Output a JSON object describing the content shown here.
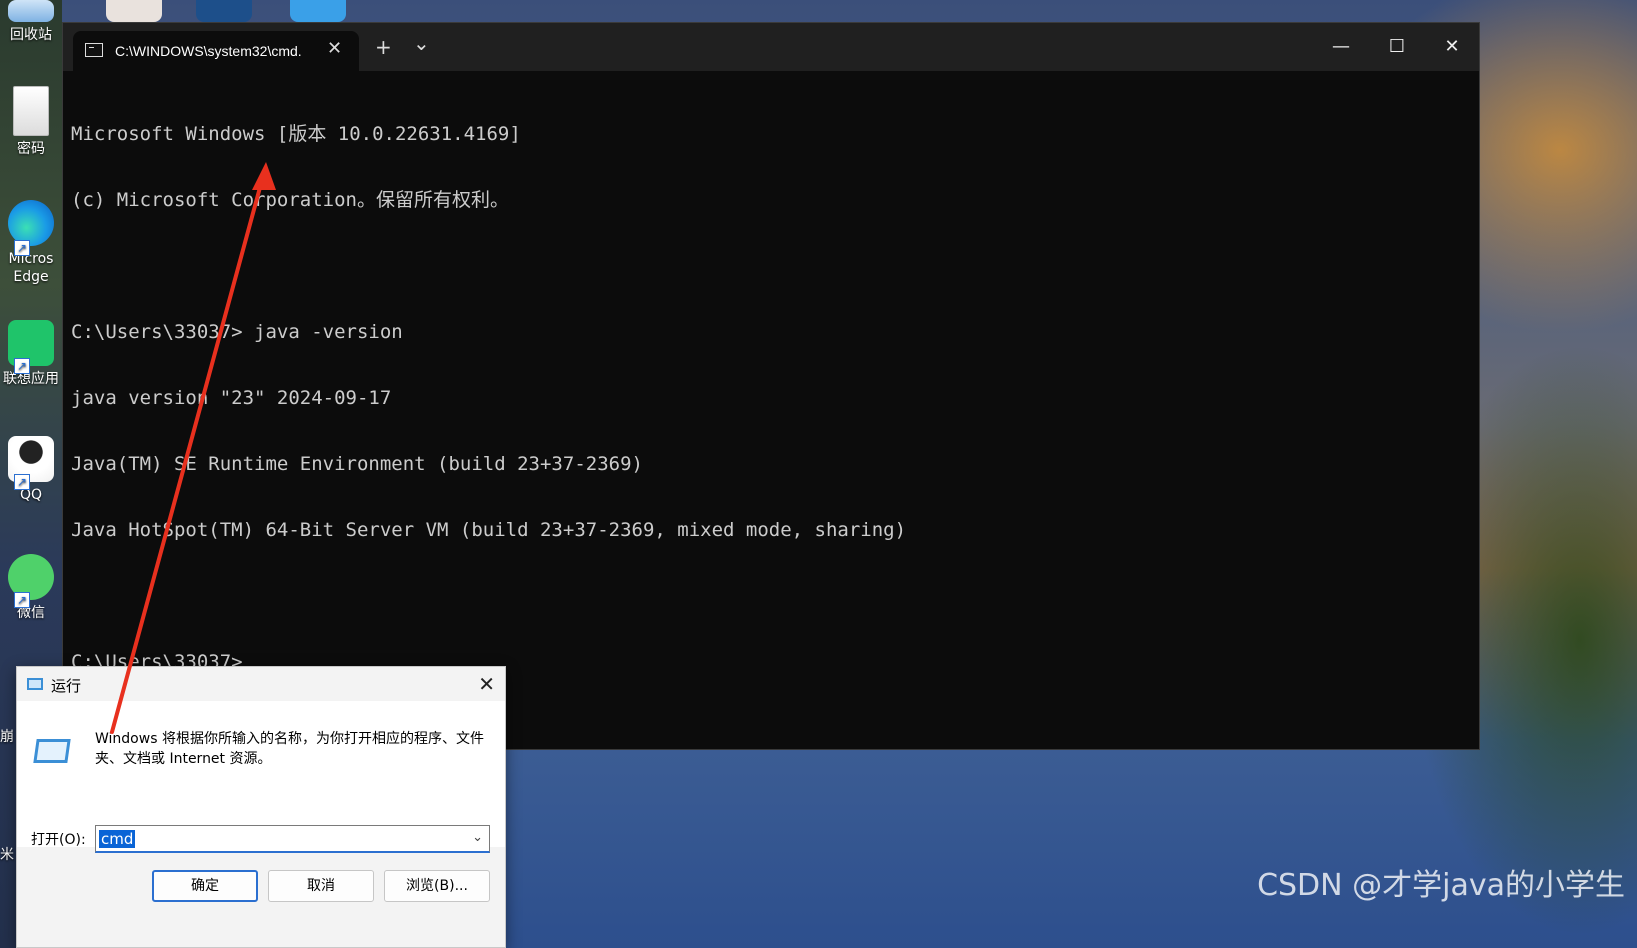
{
  "desktop": {
    "icons": [
      {
        "label": "回收站",
        "icon": "recycle-bin-icon"
      },
      {
        "label": "密码",
        "icon": "text-file-icon"
      },
      {
        "label": "Micros",
        "label2": "Edge",
        "icon": "edge-icon"
      },
      {
        "label": "联想应用",
        "icon": "lenovo-app-icon"
      },
      {
        "label": "QQ",
        "icon": "qq-icon"
      },
      {
        "label": "微信",
        "icon": "wechat-icon"
      }
    ],
    "edge_texts": [
      "崩",
      "米"
    ]
  },
  "terminal": {
    "tab_title": "C:\\WINDOWS\\system32\\cmd.",
    "tab_close": "✕",
    "new_tab": "+",
    "dropdown": "⌄",
    "minimize": "—",
    "maximize": "☐",
    "close": "✕",
    "lines": [
      "Microsoft Windows [版本 10.0.22631.4169]",
      "(c) Microsoft Corporation。保留所有权利。",
      "",
      "C:\\Users\\33037> java -version",
      "java version \"23\" 2024-09-17",
      "Java(TM) SE Runtime Environment (build 23+37-2369)",
      "Java HotSpot(TM) 64-Bit Server VM (build 23+37-2369, mixed mode, sharing)",
      "",
      "C:\\Users\\33037>"
    ]
  },
  "run_dialog": {
    "title": "运行",
    "close": "✕",
    "description": "Windows 将根据你所输入的名称，为你打开相应的程序、文件夹、文档或 Internet 资源。",
    "open_label": "打开(O):",
    "input_value": "cmd",
    "dropdown": "⌄",
    "ok": "确定",
    "cancel": "取消",
    "browse": "浏览(B)..."
  },
  "watermark": "CSDN @才学java的小学生",
  "colors": {
    "arrow": "#e8301e",
    "console_text": "#cccccc",
    "terminal_bg": "#0c0c0c",
    "accent": "#2b6fd0"
  }
}
